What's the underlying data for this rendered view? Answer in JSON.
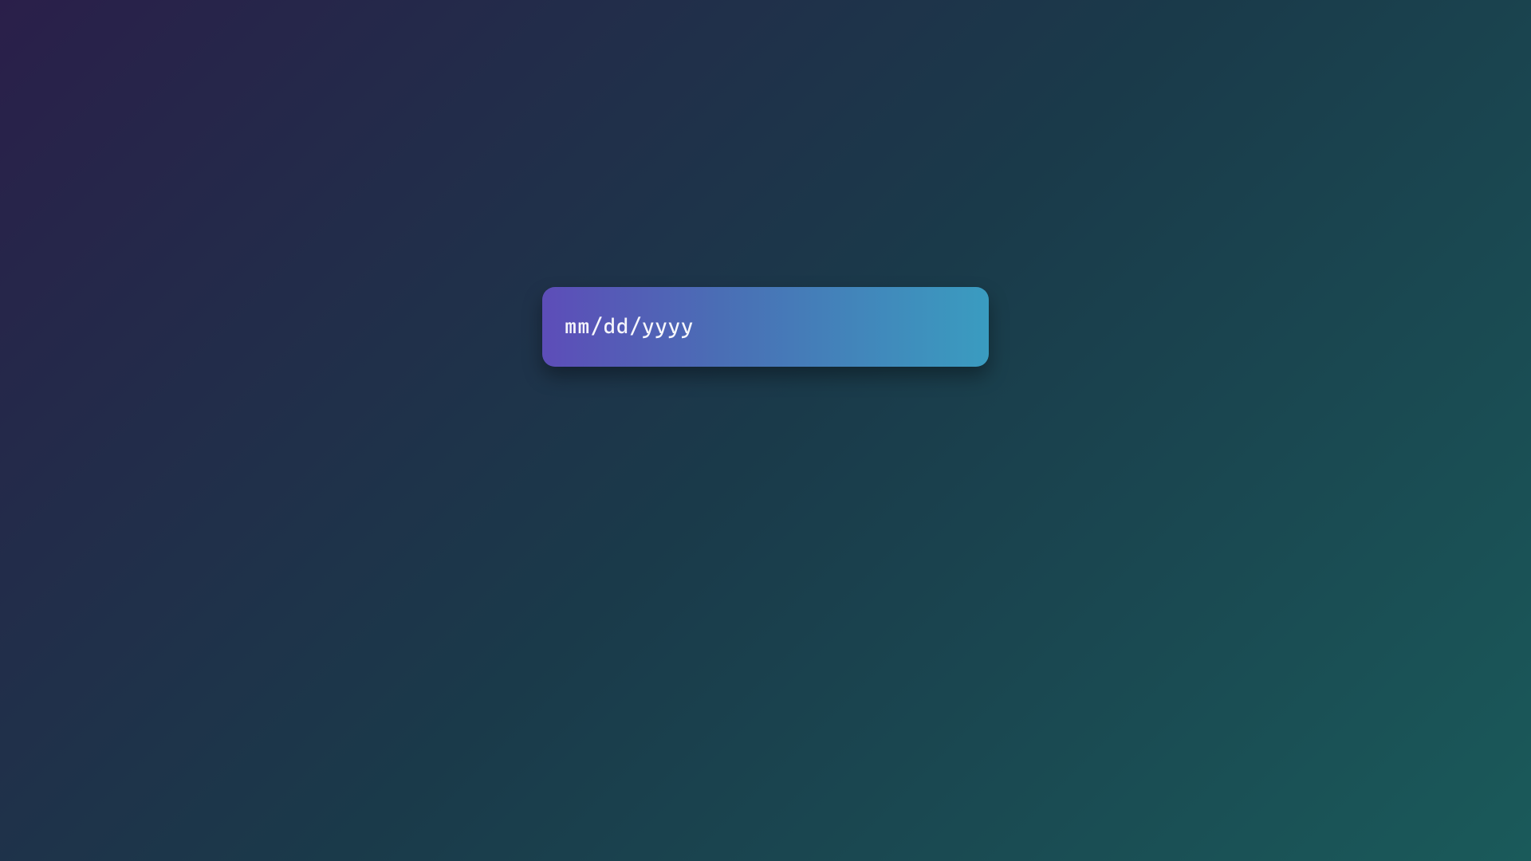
{
  "dateInput": {
    "placeholder": "mm/dd/yyyy",
    "value": ""
  },
  "colors": {
    "backgroundGradientStart": "#2a1f4a",
    "backgroundGradientEnd": "#1a5a5a",
    "inputGradientStart": "#5d4db8",
    "inputGradientEnd": "#3a9cc0",
    "textColor": "#ffffff"
  }
}
